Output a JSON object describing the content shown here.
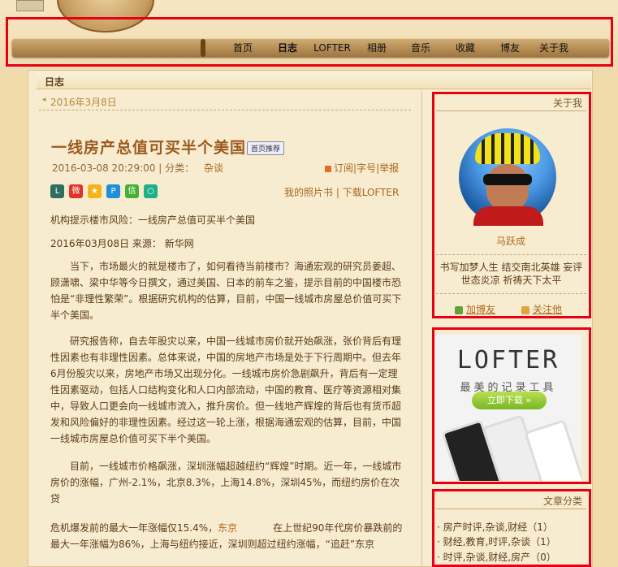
{
  "nav": {
    "items": [
      "首页",
      "日志",
      "LOFTER",
      "相册",
      "音乐",
      "收藏",
      "博友",
      "关于我"
    ]
  },
  "section": {
    "title": "日志"
  },
  "post": {
    "date_header": "2016年3月8日",
    "title": "一线房产总值可买半个美国",
    "tag": "首页推荐",
    "meta": "2016-03-08 20:29:00 | 分类：",
    "category": "杂谈",
    "ops": [
      "订阅",
      "字号",
      "举报"
    ],
    "links": [
      "我的照片书",
      "下载LOFTER"
    ],
    "p1": "机构提示楼市风险：一线房产总值可买半个美国",
    "p2": "2016年03月08日    来源：  新华网",
    "p3": "当下，市场最火的就是楼市了，如何看待当前楼市？海通宏观的研究员姜超、顾潇啸、梁中华等今日撰文，通过美国、日本的前车之鉴，提示目前的中国楼市恐怕是“非理性繁荣”。根据研究机构的估算，目前，中国一线城市房屋总价值可买下半个美国。",
    "p4": "研究报告称，自去年股灾以来，中国一线城市房价就开始飙涨，张价背后有理性因素也有非理性因素。总体来说，中国的房地产市场是处于下行周期中。但去年6月份股灾以来，房地产市场又出现分化。一线城市房价急剧飙升，背后有一定理性因素驱动，包括人口结构变化和人口内部流动，中国的教育、医疗等资源相对集中，导致人口更会向一线城市流入，推升房价。但一线地产辉煌的背后也有货币超发和风险偏好的非理性因素。经过这一轮上涨，根据海通宏观的估算，目前，中国一线城市房屋总价值可买下半个美国。",
    "p5": "目前，一线城市价格飙涨，深圳涨幅超越纽约“辉煌”时期。近一年，一线城市房价的涨幅，广州-2.1%，北京8.3%，上海14.8%，深圳45%，而纽约房价在次贷",
    "p6a": "危机爆发前的最大一年涨幅仅15.4%，",
    "p6link": "东京",
    "p6b": "在上世纪90年代房价暴跌前的最大一年涨幅为86%，上海与纽约接近，深圳则超过纽约涨幅，“追赶”东京"
  },
  "about": {
    "header": "关于我",
    "name": "马跃成",
    "bio": "书写加梦人生 结交南北英雄 妄评世态炎凉 祈祷天下太平",
    "add_friend": "加博友",
    "follow": "关注他"
  },
  "ad": {
    "logo": "LOFTER",
    "slogan": "最美的记录工具",
    "button": "立即下载 »"
  },
  "categories": {
    "header": "文章分类",
    "items": [
      "房产时评,杂谈,财经（1）",
      "财经,教育,时评,杂谈（1）",
      "时评,杂谈,财经,房产（0）"
    ]
  },
  "colors": {
    "highlight_box": "#e60012",
    "link": "#b06a1c",
    "title": "#9e5a1e"
  }
}
